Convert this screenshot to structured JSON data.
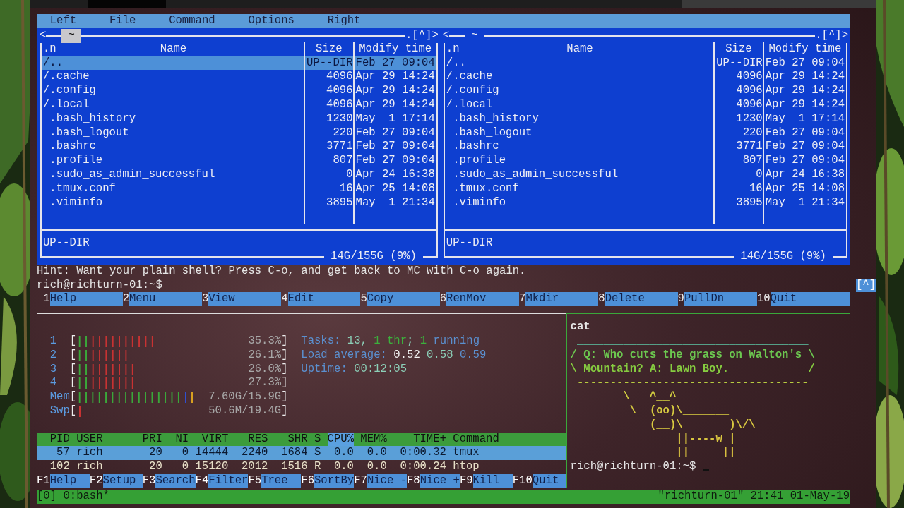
{
  "mc": {
    "menu": [
      {
        "label": "Left"
      },
      {
        "label": "File"
      },
      {
        "label": "Command"
      },
      {
        "label": "Options"
      },
      {
        "label": "Right"
      }
    ],
    "panels": [
      {
        "active": true,
        "nav": "<",
        "path": "~",
        "corner": ".[^]>",
        "sort_mark": ".n",
        "columns": [
          "Name",
          "Size",
          "Modify time"
        ],
        "files": [
          {
            "kind": "dir",
            "name": "/..",
            "size": "UP--DIR",
            "modified": "Feb 27 09:04",
            "selected": true
          },
          {
            "kind": "dir",
            "name": "/.cache",
            "size": "4096",
            "modified": "Apr 29 14:24",
            "selected": false
          },
          {
            "kind": "dir",
            "name": "/.config",
            "size": "4096",
            "modified": "Apr 29 14:24",
            "selected": false
          },
          {
            "kind": "dir",
            "name": "/.local",
            "size": "4096",
            "modified": "Apr 29 14:24",
            "selected": false
          },
          {
            "kind": "file",
            "name": ".bash_history",
            "size": "1230",
            "modified": "May  1 17:14",
            "selected": false
          },
          {
            "kind": "file",
            "name": ".bash_logout",
            "size": "220",
            "modified": "Feb 27 09:04",
            "selected": false
          },
          {
            "kind": "file",
            "name": ".bashrc",
            "size": "3771",
            "modified": "Feb 27 09:04",
            "selected": false
          },
          {
            "kind": "file",
            "name": ".profile",
            "size": "807",
            "modified": "Feb 27 09:04",
            "selected": false
          },
          {
            "kind": "file",
            "name": ".sudo_as_admin_successful",
            "size": "0",
            "modified": "Apr 24 16:38",
            "selected": false
          },
          {
            "kind": "file",
            "name": ".tmux.conf",
            "size": "16",
            "modified": "Apr 25 14:08",
            "selected": false
          },
          {
            "kind": "file",
            "name": ".viminfo",
            "size": "3895",
            "modified": "May  1 21:34",
            "selected": false
          }
        ],
        "status": "UP--DIR",
        "disk": "14G/155G (9%)"
      },
      {
        "active": false,
        "nav": "<",
        "path": "~",
        "corner": ".[^]>",
        "sort_mark": ".n",
        "columns": [
          "Name",
          "Size",
          "Modify time"
        ],
        "files": [
          {
            "kind": "dir",
            "name": "/..",
            "size": "UP--DIR",
            "modified": "Feb 27 09:04",
            "selected": false
          },
          {
            "kind": "dir",
            "name": "/.cache",
            "size": "4096",
            "modified": "Apr 29 14:24",
            "selected": false
          },
          {
            "kind": "dir",
            "name": "/.config",
            "size": "4096",
            "modified": "Apr 29 14:24",
            "selected": false
          },
          {
            "kind": "dir",
            "name": "/.local",
            "size": "4096",
            "modified": "Apr 29 14:24",
            "selected": false
          },
          {
            "kind": "file",
            "name": ".bash_history",
            "size": "1230",
            "modified": "May  1 17:14",
            "selected": false
          },
          {
            "kind": "file",
            "name": ".bash_logout",
            "size": "220",
            "modified": "Feb 27 09:04",
            "selected": false
          },
          {
            "kind": "file",
            "name": ".bashrc",
            "size": "3771",
            "modified": "Feb 27 09:04",
            "selected": false
          },
          {
            "kind": "file",
            "name": ".profile",
            "size": "807",
            "modified": "Feb 27 09:04",
            "selected": false
          },
          {
            "kind": "file",
            "name": ".sudo_as_admin_successful",
            "size": "0",
            "modified": "Apr 24 16:38",
            "selected": false
          },
          {
            "kind": "file",
            "name": ".tmux.conf",
            "size": "16",
            "modified": "Apr 25 14:08",
            "selected": false
          },
          {
            "kind": "file",
            "name": ".viminfo",
            "size": "3895",
            "modified": "May  1 21:34",
            "selected": false
          }
        ],
        "status": "UP--DIR",
        "disk": "14G/155G (9%)"
      }
    ],
    "hint": "Hint: Want your plain shell? Press C-o, and get back to MC with C-o again.",
    "prompt": "rich@richturn-01:~$",
    "history_button": "[^]",
    "keybar": [
      {
        "key": "1",
        "label": "Help"
      },
      {
        "key": "2",
        "label": "Menu"
      },
      {
        "key": "3",
        "label": "View"
      },
      {
        "key": "4",
        "label": "Edit"
      },
      {
        "key": "5",
        "label": "Copy"
      },
      {
        "key": "6",
        "label": "RenMov"
      },
      {
        "key": "7",
        "label": "Mkdir"
      },
      {
        "key": "8",
        "label": "Delete"
      },
      {
        "key": "9",
        "label": "PullDn"
      },
      {
        "key": "10",
        "label": "Quit"
      }
    ]
  },
  "htop": {
    "meters": [
      {
        "kind": "cpu",
        "label": "1",
        "open": "[",
        "close": "]",
        "reading": "35.3%"
      },
      {
        "kind": "cpu",
        "label": "2",
        "open": "[",
        "close": "]",
        "reading": "26.1%"
      },
      {
        "kind": "cpu",
        "label": "3",
        "open": "[",
        "close": "]",
        "reading": "26.0%"
      },
      {
        "kind": "cpu",
        "label": "4",
        "open": "[",
        "close": "]",
        "reading": "27.3%"
      },
      {
        "kind": "memory",
        "label": "Mem",
        "open": "[",
        "close": "]",
        "reading": "7.60G/15.9G"
      },
      {
        "kind": "swap",
        "label": "Swp",
        "open": "[",
        "close": "]",
        "reading": "50.6M/19.4G"
      }
    ],
    "info": [
      [
        {
          "text": "Tasks: ",
          "kind": "label"
        },
        {
          "text": "13, ",
          "kind": "value"
        },
        {
          "text": "1 thr",
          "kind": "thread"
        },
        {
          "text": "; ",
          "kind": "value"
        },
        {
          "text": "1",
          "kind": "thread"
        },
        {
          "text": " running",
          "kind": "label"
        }
      ],
      [
        {
          "text": "Load average: ",
          "kind": "label"
        },
        {
          "text": "0.52 ",
          "kind": "bright"
        },
        {
          "text": "0.58 ",
          "kind": "value"
        },
        {
          "text": "0.59",
          "kind": "label"
        }
      ],
      [
        {
          "text": "Uptime: ",
          "kind": "label"
        },
        {
          "text": "00:12:05",
          "kind": "value"
        }
      ]
    ],
    "columns": [
      {
        "label": "PID",
        "selected": false
      },
      {
        "label": "USER",
        "selected": false
      },
      {
        "label": "PRI",
        "selected": false
      },
      {
        "label": "NI",
        "selected": false
      },
      {
        "label": "VIRT",
        "selected": false
      },
      {
        "label": "RES",
        "selected": false
      },
      {
        "label": "SHR",
        "selected": false
      },
      {
        "label": "S",
        "selected": false
      },
      {
        "label": "CPU%",
        "selected": true
      },
      {
        "label": "MEM%",
        "selected": false
      },
      {
        "label": "TIME+",
        "selected": false
      },
      {
        "label": "Command",
        "selected": false
      }
    ],
    "processes": [
      {
        "selected": true,
        "cells": [
          "57",
          "rich",
          "20",
          "0",
          "14444",
          "2240",
          "1684",
          "S",
          "0.0",
          "0.0",
          "0:00.32",
          "tmux"
        ]
      },
      {
        "selected": false,
        "cells": [
          "102",
          "rich",
          "20",
          "0",
          "15120",
          "2012",
          "1516",
          "R",
          "0.0",
          "0.0",
          "0:00.24",
          "htop"
        ]
      }
    ],
    "fkeys": [
      {
        "key": "F1",
        "label": "Help"
      },
      {
        "key": "F2",
        "label": "Setup"
      },
      {
        "key": "F3",
        "label": "Search"
      },
      {
        "key": "F4",
        "label": "Filter"
      },
      {
        "key": "F5",
        "label": "Tree"
      },
      {
        "key": "F6",
        "label": "SortBy"
      },
      {
        "key": "F7",
        "label": "Nice -"
      },
      {
        "key": "F8",
        "label": "Nice +"
      },
      {
        "key": "F9",
        "label": "Kill"
      },
      {
        "key": "F10",
        "label": "Quit"
      }
    ]
  },
  "shell": {
    "lines": [
      {
        "text": "cat",
        "color": "#e6e6e6"
      },
      {
        "text": " ___________________________________"
      },
      {
        "text": "/ Q: Who cuts the grass on Walton's \\",
        "color": "#6cc850"
      },
      {
        "text": "\\ Mountain? A: Lawn Boy.            /",
        "color": "#86cc40"
      },
      {
        "text": " -----------------------------------",
        "color": "#b8cc40"
      },
      {
        "text": "        \\   ^__^",
        "color": "#d0cc40"
      },
      {
        "text": "         \\  (oo)\\_______",
        "color": "#d4c840"
      },
      {
        "text": "            (__)\\       )\\/\\",
        "color": "#d8c840"
      },
      {
        "text": "                ||----w |",
        "color": "#d8c440"
      },
      {
        "text": "                ||     ||",
        "color": "#d8c040"
      }
    ],
    "prompt": "rich@richturn-01:~$"
  },
  "tmux": {
    "left": "[0] 0:bash*",
    "right": "\"richturn-01\" 21:41 01-May-19"
  }
}
